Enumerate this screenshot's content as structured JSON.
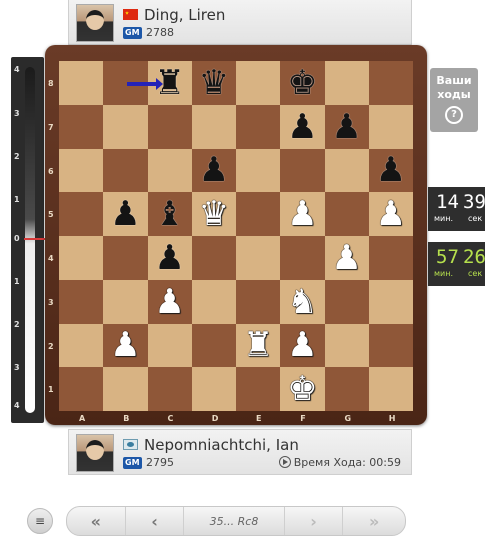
{
  "top_player": {
    "name": "Ding, Liren",
    "title": "GM",
    "rating": "2788",
    "flag": "china-flag-icon"
  },
  "bottom_player": {
    "name": "Nepomniachtchi, Ian",
    "title": "GM",
    "rating": "2795",
    "flag": "fide-flag-icon",
    "move_time_label": "Время Хода: 00:59"
  },
  "eval_ticks": [
    "4",
    "3",
    "2",
    "1",
    "0",
    "1",
    "2",
    "3",
    "4"
  ],
  "board": {
    "files": [
      "A",
      "B",
      "C",
      "D",
      "E",
      "F",
      "G",
      "H"
    ],
    "ranks": [
      "8",
      "7",
      "6",
      "5",
      "4",
      "3",
      "2",
      "1"
    ],
    "rows": [
      [
        "",
        "",
        "br",
        "bq",
        "",
        "bk",
        "",
        ""
      ],
      [
        "",
        "",
        "",
        "",
        "",
        "bp",
        "bp",
        ""
      ],
      [
        "",
        "",
        "",
        "bp",
        "",
        "",
        "",
        "bp"
      ],
      [
        "",
        "bp",
        "bb",
        "wq",
        "",
        "wp",
        "",
        "wp"
      ],
      [
        "",
        "",
        "bp",
        "",
        "",
        "",
        "wp",
        ""
      ],
      [
        "",
        "",
        "wp",
        "",
        "",
        "wn",
        "",
        ""
      ],
      [
        "",
        "wp",
        "",
        "",
        "wr",
        "wp",
        "",
        ""
      ],
      [
        "",
        "",
        "",
        "",
        "",
        "wk",
        "",
        ""
      ]
    ],
    "arrow": {
      "from": "b8",
      "to": "c8",
      "color": "#2323b8"
    }
  },
  "your_move": {
    "label_line1": "Ваши",
    "label_line2": "ходы",
    "help": "?"
  },
  "clock_top": {
    "minutes": "14",
    "seconds": "39",
    "min_label": "мин.",
    "sec_label": "сек"
  },
  "clock_bottom": {
    "minutes": "57",
    "seconds": "26",
    "min_label": "мин.",
    "sec_label": "сек"
  },
  "nav": {
    "first": "«",
    "prev": "‹",
    "current_move": "35... Rc8",
    "next": "›",
    "last": "»",
    "menu": "≡"
  }
}
